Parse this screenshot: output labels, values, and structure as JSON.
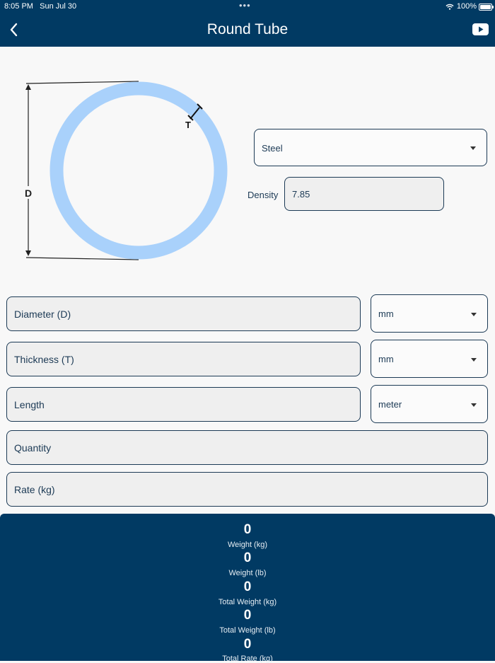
{
  "status": {
    "time": "8:05 PM",
    "date": "Sun Jul 30",
    "battery": "100%"
  },
  "header": {
    "title": "Round Tube",
    "back_icon": "chevron-left-icon",
    "video_icon": "youtube-icon"
  },
  "diagram": {
    "diameter_label": "D",
    "thickness_label": "T",
    "ring_color": "#a9d1fb"
  },
  "material": {
    "selected": "Steel"
  },
  "density": {
    "label": "Density",
    "value": "7.85"
  },
  "fields": {
    "diameter": {
      "placeholder": "Diameter (D)",
      "unit": "mm"
    },
    "thickness": {
      "placeholder": "Thickness (T)",
      "unit": "mm"
    },
    "length": {
      "placeholder": "Length",
      "unit": "meter"
    },
    "quantity": {
      "placeholder": "Quantity"
    },
    "rate": {
      "placeholder": "Rate (kg)"
    }
  },
  "results": [
    {
      "value": "0",
      "label": "Weight (kg)"
    },
    {
      "value": "0",
      "label": "Weight (lb)"
    },
    {
      "value": "0",
      "label": "Total Weight (kg)"
    },
    {
      "value": "0",
      "label": "Total Weight (lb)"
    },
    {
      "value": "0",
      "label": "Total Rate (kg)"
    }
  ],
  "colors": {
    "primary": "#013a63",
    "field_border": "#1c3a55",
    "field_bg": "#efefef"
  }
}
